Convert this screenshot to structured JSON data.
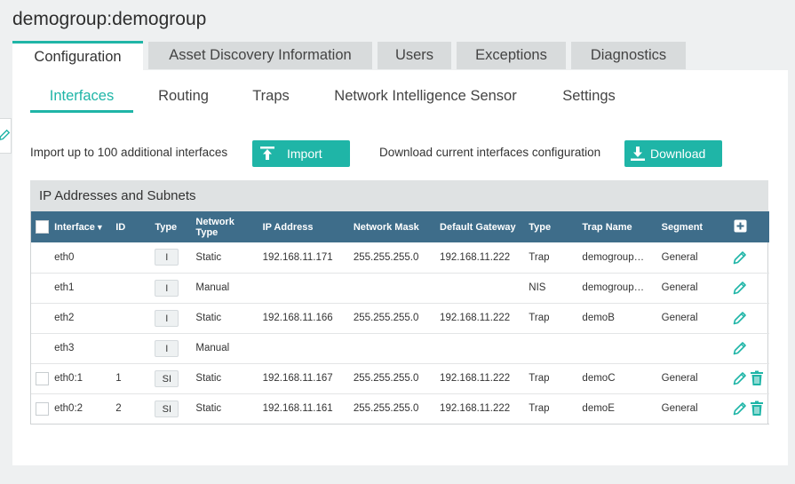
{
  "page": {
    "title": "demogroup:demogroup"
  },
  "colors": {
    "accent": "#1fb5a7",
    "table_header": "#3e6d8a",
    "tab_inactive": "#d8dbdc"
  },
  "main_tabs": [
    {
      "label": "Configuration",
      "active": true
    },
    {
      "label": "Asset Discovery Information",
      "active": false
    },
    {
      "label": "Users",
      "active": false
    },
    {
      "label": "Exceptions",
      "active": false
    },
    {
      "label": "Diagnostics",
      "active": false
    }
  ],
  "sub_tabs": [
    {
      "label": "Interfaces",
      "active": true
    },
    {
      "label": "Routing",
      "active": false
    },
    {
      "label": "Traps",
      "active": false
    },
    {
      "label": "Network Intelligence Sensor",
      "active": false
    },
    {
      "label": "Settings",
      "active": false
    }
  ],
  "import": {
    "text": "Import up to 100 additional interfaces",
    "button_label": "Import",
    "button_icon": "upload-icon"
  },
  "download": {
    "text": "Download current interfaces configuration",
    "button_label": "Download",
    "button_icon": "download-icon"
  },
  "section": {
    "title": "IP Addresses and Subnets"
  },
  "table": {
    "columns": {
      "interface": "Interface",
      "id": "ID",
      "type": "Type",
      "network_type_line1": "Network",
      "network_type_line2": "Type",
      "ip_address": "IP Address",
      "network_mask": "Network Mask",
      "default_gateway": "Default Gateway",
      "type2": "Type",
      "trap_name": "Trap Name",
      "segment": "Segment"
    },
    "sort_icon": "sort-down-icon",
    "add_icon": "plus-square-icon",
    "rows": [
      {
        "checkbox": false,
        "interface": "eth0",
        "id": "",
        "type": "I",
        "network_type": "Static",
        "ip": "192.168.11.171",
        "mask": "255.255.255.0",
        "gateway": "192.168.11.222",
        "type2": "Trap",
        "trap_name": "demogroup…",
        "segment": "General",
        "deletable": false
      },
      {
        "checkbox": false,
        "interface": "eth1",
        "id": "",
        "type": "I",
        "network_type": "Manual",
        "ip": "",
        "mask": "",
        "gateway": "",
        "type2": "NIS",
        "trap_name": "demogroup…",
        "segment": "General",
        "deletable": false
      },
      {
        "checkbox": false,
        "interface": "eth2",
        "id": "",
        "type": "I",
        "network_type": "Static",
        "ip": "192.168.11.166",
        "mask": "255.255.255.0",
        "gateway": "192.168.11.222",
        "type2": "Trap",
        "trap_name": "demoB",
        "segment": "General",
        "deletable": false
      },
      {
        "checkbox": false,
        "interface": "eth3",
        "id": "",
        "type": "I",
        "network_type": "Manual",
        "ip": "",
        "mask": "",
        "gateway": "",
        "type2": "",
        "trap_name": "",
        "segment": "",
        "deletable": false
      },
      {
        "checkbox": true,
        "interface": "eth0:1",
        "id": "1",
        "type": "SI",
        "network_type": "Static",
        "ip": "192.168.11.167",
        "mask": "255.255.255.0",
        "gateway": "192.168.11.222",
        "type2": "Trap",
        "trap_name": "demoC",
        "segment": "General",
        "deletable": true
      },
      {
        "checkbox": true,
        "interface": "eth0:2",
        "id": "2",
        "type": "SI",
        "network_type": "Static",
        "ip": "192.168.11.161",
        "mask": "255.255.255.0",
        "gateway": "192.168.11.222",
        "type2": "Trap",
        "trap_name": "demoE",
        "segment": "General",
        "deletable": true
      }
    ],
    "row_icons": {
      "edit": "pencil-icon",
      "delete": "trash-icon"
    }
  }
}
